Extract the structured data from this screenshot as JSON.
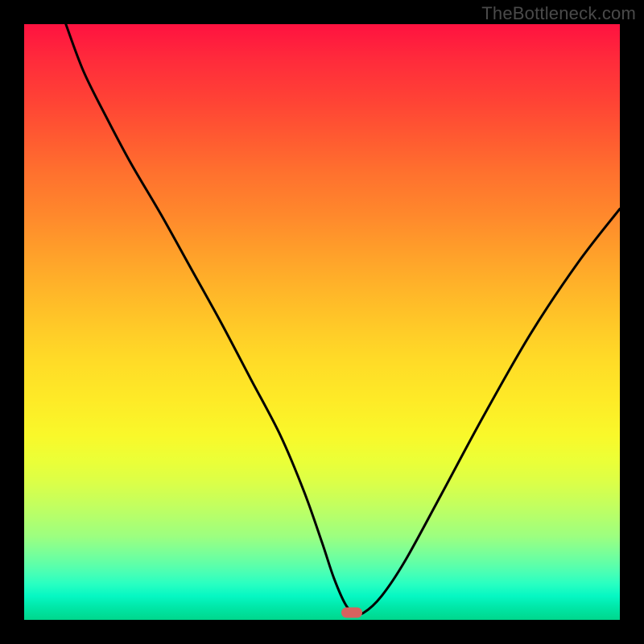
{
  "watermark": "TheBottleneck.com",
  "chart_data": {
    "type": "line",
    "title": "",
    "xlabel": "",
    "ylabel": "",
    "xlim": [
      0,
      100
    ],
    "ylim": [
      0,
      100
    ],
    "grid": false,
    "legend": false,
    "series": [
      {
        "name": "bottleneck-curve",
        "x": [
          7,
          10,
          14,
          18,
          23,
          28,
          33,
          38,
          43,
          47,
          50,
          52,
          54,
          55.5,
          57,
          60,
          64,
          70,
          77,
          85,
          93,
          100
        ],
        "values": [
          100,
          92,
          84,
          76.5,
          68,
          59,
          50,
          40.5,
          31,
          21.5,
          13,
          7,
          2.5,
          1.2,
          1.2,
          4,
          10,
          21,
          34,
          48,
          60,
          69
        ]
      }
    ],
    "marker": {
      "x": 55,
      "y": 1.2
    },
    "gradient_colors": {
      "top": "#ff1240",
      "mid": "#ffc728",
      "bottom": "#00d78c"
    }
  }
}
